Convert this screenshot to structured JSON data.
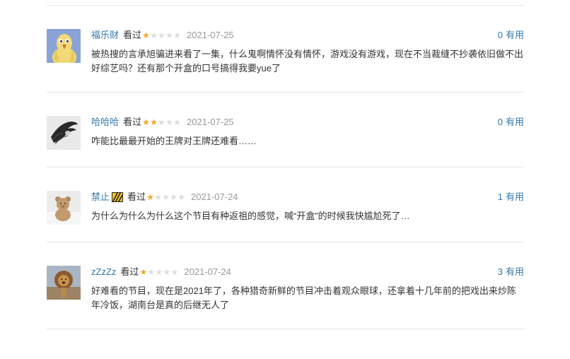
{
  "comments": [
    {
      "user": "福乐财",
      "status": "看过",
      "rating": 1,
      "time": "2021-07-25",
      "votes": "0",
      "vote_label": "有用",
      "text": "被热搜的言承旭骗进来看了一集，什么鬼啊情怀没有情怀，游戏没有游戏，现在不当裁缝不抄袭依旧做不出好综艺吗？还有那个开盒的口号搞得我要yue了"
    },
    {
      "user": "哈哈哈",
      "status": "看过",
      "rating": 2,
      "time": "2021-07-25",
      "votes": "0",
      "vote_label": "有用",
      "text": "咋能比最最开始的王牌对王牌还难看……"
    },
    {
      "user": "禁止",
      "status": "看过",
      "rating": 1,
      "time": "2021-07-24",
      "votes": "1",
      "vote_label": "有用",
      "text": "为什么为什么为什么这个节目有种返祖的感觉，喊“开盒”的时候我快尴尬死了…"
    },
    {
      "user": "zZzZz",
      "status": "看过",
      "rating": 1,
      "time": "2021-07-24",
      "votes": "3",
      "vote_label": "有用",
      "text": "好难看的节目，现在是2021年了，各种猎奇新鲜的节目冲击着观众眼球，还拿着十几年前的把戏出来炒陈年冷饭，湖南台是真的后继无人了"
    }
  ]
}
